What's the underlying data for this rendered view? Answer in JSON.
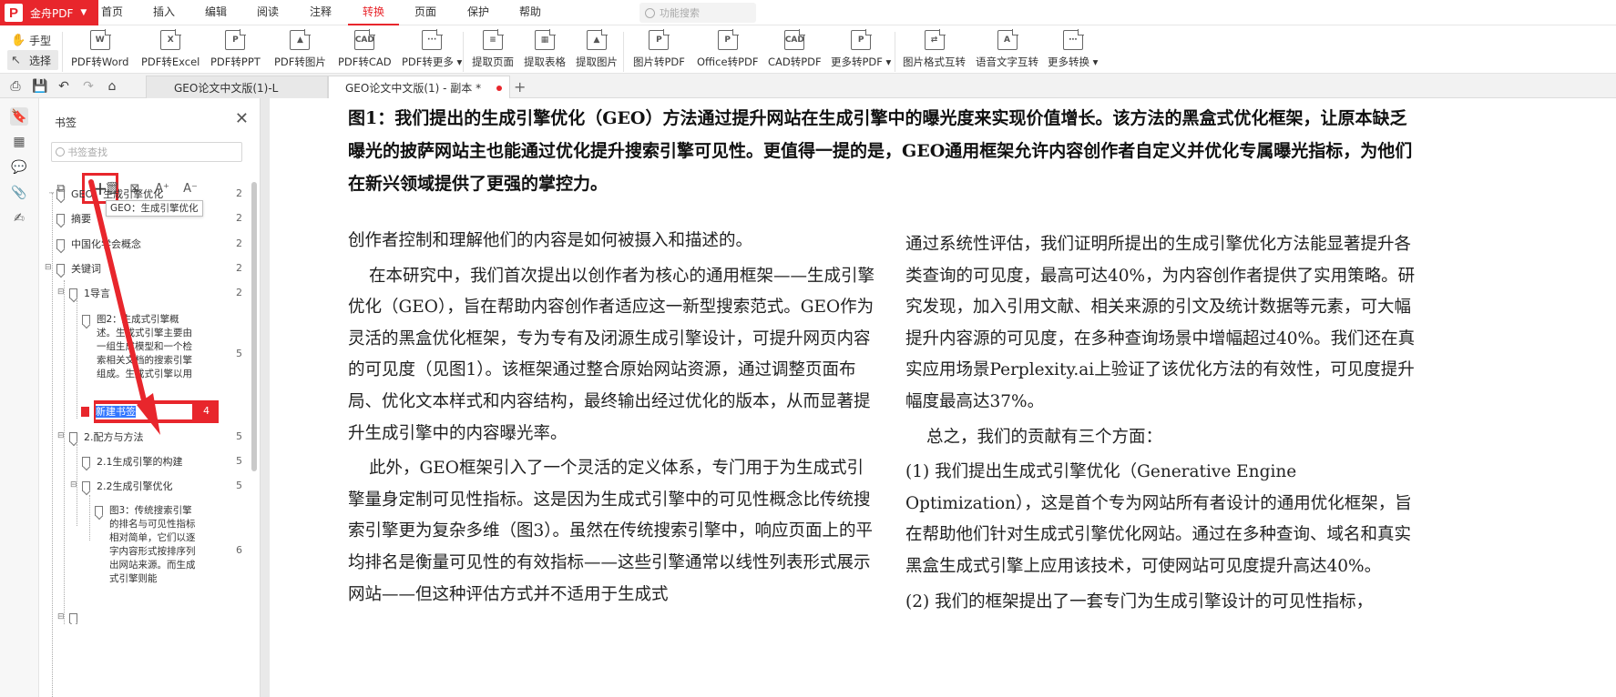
{
  "brand": {
    "name": "金舟PDF",
    "logo_letter": "P",
    "accent": "#e8262c"
  },
  "menu": [
    "首页",
    "插入",
    "编辑",
    "阅读",
    "注释",
    "转换",
    "页面",
    "保护",
    "帮助"
  ],
  "menu_active": "转换",
  "feature_search_placeholder": "功能搜索",
  "ribbon": {
    "hand": "手型",
    "select": "选择",
    "buttons": [
      {
        "label": "PDF转Word",
        "icon": "W"
      },
      {
        "label": "PDF转Excel",
        "icon": "X"
      },
      {
        "label": "PDF转PPT",
        "icon": "P"
      },
      {
        "label": "PDF转图片",
        "icon": "▲"
      },
      {
        "label": "PDF转CAD",
        "icon": "CAD"
      },
      {
        "label": "PDF转更多 ▾",
        "icon": "···"
      },
      {
        "label": "提取页面",
        "icon": "≡"
      },
      {
        "label": "提取表格",
        "icon": "▦"
      },
      {
        "label": "提取图片",
        "icon": "▲"
      },
      {
        "label": "图片转PDF",
        "icon": "P"
      },
      {
        "label": "Office转PDF",
        "icon": "P"
      },
      {
        "label": "CAD转PDF",
        "icon": "CAD"
      },
      {
        "label": "更多转PDF ▾",
        "icon": "P"
      },
      {
        "label": "图片格式互转",
        "icon": "⇄"
      },
      {
        "label": "语音文字互转",
        "icon": "A"
      },
      {
        "label": "更多转换 ▾",
        "icon": "⋯"
      }
    ]
  },
  "tabs": [
    {
      "label": "GEO论文中文版(1)-L"
    },
    {
      "label": "GEO论文中文版(1) - 副本 *"
    }
  ],
  "panel": {
    "title": "书签",
    "search_placeholder": "书签查找",
    "tooltip": "GEO：生成引擎优化",
    "new_bookmark": {
      "text": "新建书签",
      "page": "4"
    },
    "items": [
      {
        "text": "GEO：生成引擎优化",
        "page": "2"
      },
      {
        "text": "摘要",
        "page": "2"
      },
      {
        "text": "中国化学会概念",
        "page": "2"
      },
      {
        "text": "关键词",
        "page": "2"
      },
      {
        "text": "1导言",
        "page": "2"
      },
      {
        "text": "图2：生成式引擎概述。生成式引擎主要由一组生成模型和一个检索相关文档的搜索引擎组成。生成式引擎以用",
        "page": "5"
      },
      {
        "text": "2.配方与方法",
        "page": "5"
      },
      {
        "text": "2.1生成引擎的构建",
        "page": "5"
      },
      {
        "text": "2.2生成引擎优化",
        "page": "5"
      },
      {
        "text": "图3：传统搜索引擎的排名与可见性指标相对简单，它们以逐字内容形式按排序列出网站来源。而生成式引擎则能",
        "page": "6"
      }
    ]
  },
  "document": {
    "caption": "图1：我们提出的生成引擎优化（GEO）方法通过提升网站在生成引擎中的曝光度来实现价值增长。该方法的黑盒式优化框架，让原本缺乏曝光的披萨网站主也能通过优化提升搜索引擎可见性。更值得一提的是，GEO通用框架允许内容创作者自定义并优化专属曝光指标，为他们在新兴领域提供了更强的掌控力。",
    "left_col": [
      "创作者控制和理解他们的内容是如何被摄入和描述的。",
      "在本研究中，我们首次提出以创作者为核心的通用框架——生成引擎优化（GEO），旨在帮助内容创作者适应这一新型搜索范式。GEO作为灵活的黑盒优化框架，专为专有及闭源生成引擎设计，可提升网页内容的可见度（见图1）。该框架通过整合原始网站资源，通过调整页面布局、优化文本样式和内容结构，最终输出经过优化的版本，从而显著提升生成引擎中的内容曝光率。",
      "此外，GEO框架引入了一个灵活的定义体系，专门用于为生成式引擎量身定制可见性指标。这是因为生成式引擎中的可见性概念比传统搜索引擎更为复杂多维（图3）。虽然在传统搜索引擎中，响应页面上的平均排名是衡量可见性的有效指标——这些引擎通常以线性列表形式展示网站——但这种评估方式并不适用于生成式"
    ],
    "right_col": [
      "通过系统性评估，我们证明所提出的生成引擎优化方法能显著提升各类查询的可见度，最高可达40%，为内容创作者提供了实用策略。研究发现，加入引用文献、相关来源的引文及统计数据等元素，可大幅提升内容源的可见度，在多种查询场景中增幅超过40%。我们还在真实应用场景Perplexity.ai上验证了该优化方法的有效性，可见度提升幅度最高达37%。",
      "总之，我们的贡献有三个方面：",
      "(1) 我们提出生成式引擎优化（Generative Engine Optimization），这是首个专为网站所有者设计的通用优化框架，旨在帮助他们针对生成式引擎优化网站。通过在多种查询、域名和真实黑盒生成式引擎上应用该技术，可使网站可见度提升高达40%。",
      "(2) 我们的框架提出了一套专门为生成引擎设计的可见性指标，"
    ]
  }
}
